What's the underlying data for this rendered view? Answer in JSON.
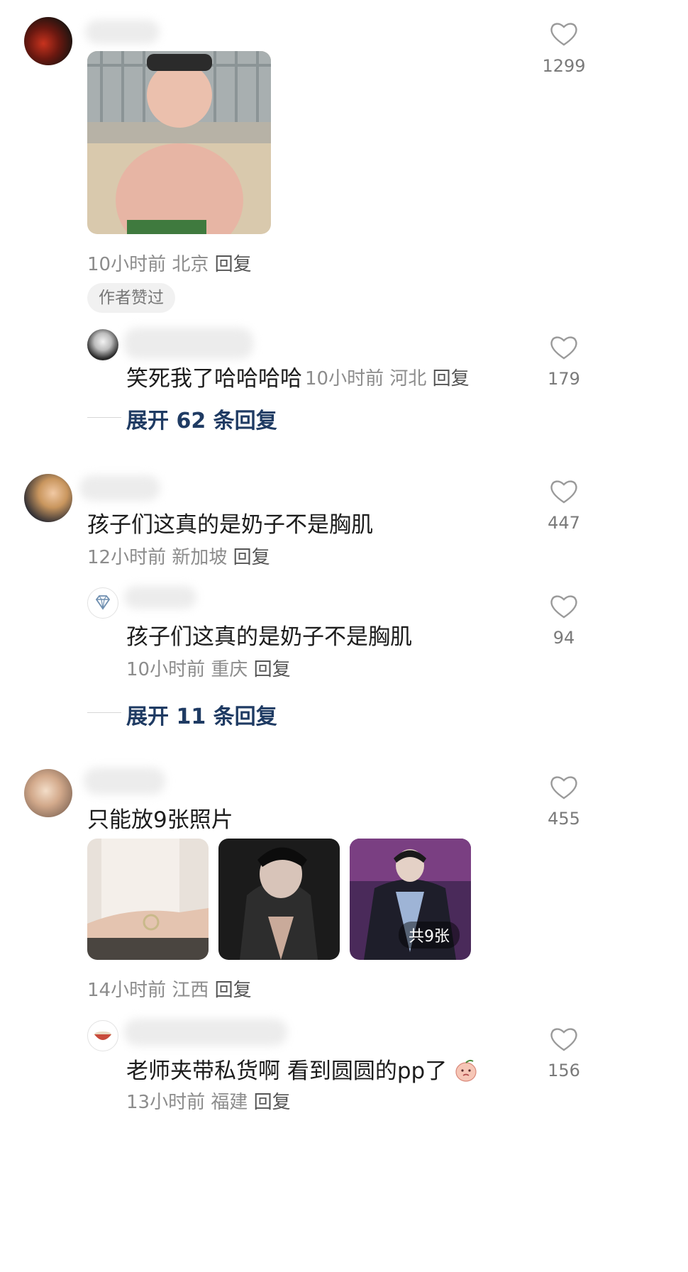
{
  "comments": [
    {
      "like_count": "1299",
      "time": "10小时前",
      "location": "北京",
      "reply_label": "回复",
      "author_badge": "作者赞过",
      "replies": [
        {
          "text": "笑死我了哈哈哈哈",
          "time": "10小时前",
          "location": "河北",
          "reply_label": "回复",
          "like_count": "179"
        }
      ],
      "expand_label": "展开 62 条回复"
    },
    {
      "text": "孩子们这真的是奶子不是胸肌",
      "like_count": "447",
      "time": "12小时前",
      "location": "新加坡",
      "reply_label": "回复",
      "replies": [
        {
          "text": "孩子们这真的是奶子不是胸肌",
          "time": "10小时前",
          "location": "重庆",
          "reply_label": "回复",
          "like_count": "94"
        }
      ],
      "expand_label": "展开 11 条回复"
    },
    {
      "text": "只能放9张照片",
      "like_count": "455",
      "time": "14小时前",
      "location": "江西",
      "reply_label": "回复",
      "image_count_label": "共9张",
      "replies": [
        {
          "text": "老师夹带私货啊 看到圆圆的pp了",
          "time": "13小时前",
          "location": "福建",
          "reply_label": "回复",
          "like_count": "156"
        }
      ]
    }
  ],
  "colors": {
    "expand_text": "#1f3b63",
    "meta_text": "#8c8c8c",
    "like_icon": "#9a9a9a"
  },
  "icons": {
    "like": "heart-outline-icon",
    "verified_badge": "diamond-icon",
    "sticker": "peach-face-icon"
  }
}
